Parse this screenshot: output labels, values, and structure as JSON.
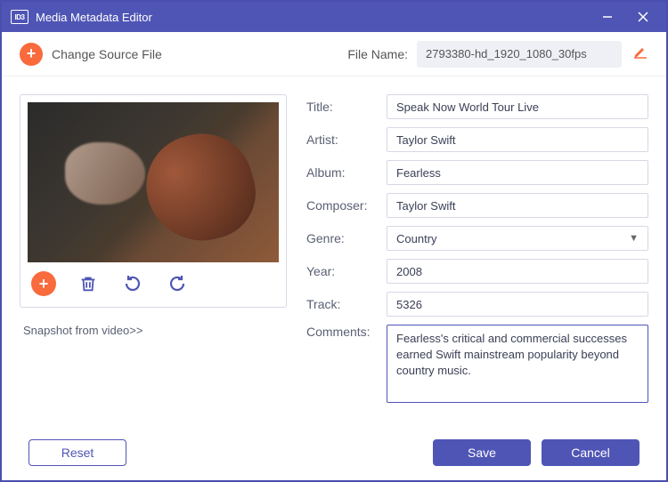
{
  "window": {
    "title": "Media Metadata Editor"
  },
  "toolbar": {
    "change_source_label": "Change Source File",
    "file_name_label": "File Name:",
    "file_name_value": "2793380-hd_1920_1080_30fps"
  },
  "snapshot_link": "Snapshot from video>>",
  "form": {
    "title": {
      "label": "Title:",
      "value": "Speak Now World Tour Live"
    },
    "artist": {
      "label": "Artist:",
      "value": "Taylor Swift"
    },
    "album": {
      "label": "Album:",
      "value": "Fearless"
    },
    "composer": {
      "label": "Composer:",
      "value": "Taylor Swift"
    },
    "genre": {
      "label": "Genre:",
      "value": "Country"
    },
    "year": {
      "label": "Year:",
      "value": "2008"
    },
    "track": {
      "label": "Track:",
      "value": "5326"
    },
    "comments": {
      "label": "Comments:",
      "value": "Fearless's critical and commercial successes earned Swift mainstream popularity beyond country music."
    }
  },
  "buttons": {
    "reset": "Reset",
    "save": "Save",
    "cancel": "Cancel"
  },
  "colors": {
    "accent": "#4f55b5",
    "orange": "#f96a3c"
  }
}
